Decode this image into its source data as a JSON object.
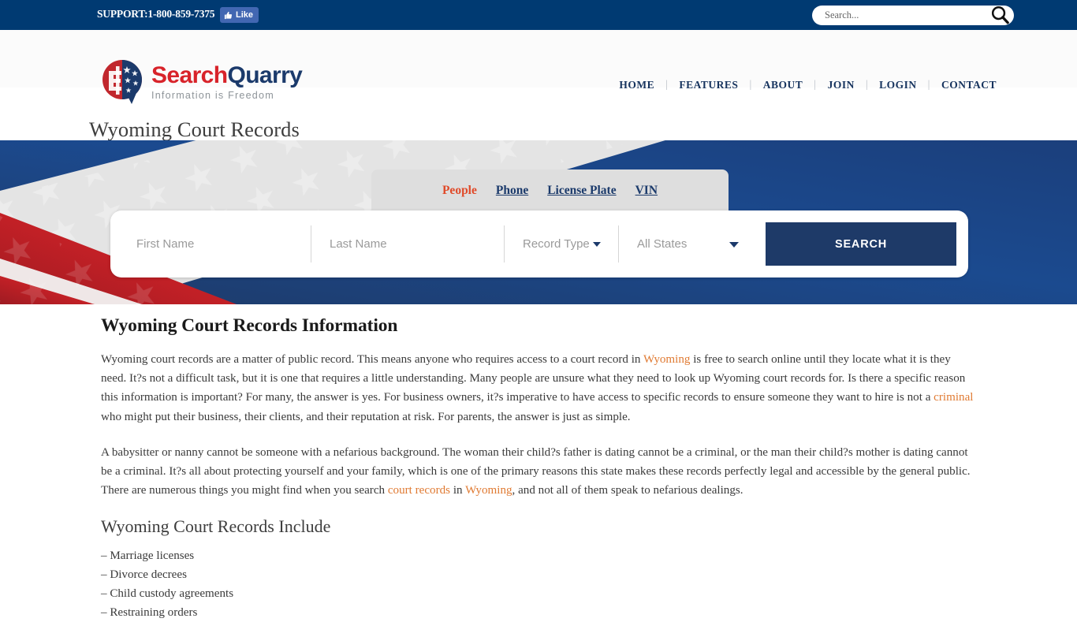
{
  "topbar": {
    "support": "SUPPORT:1-800-859-7375",
    "like_label": "Like",
    "search_placeholder": "Search...",
    "search_value": ""
  },
  "brand": {
    "name_part1": "Search",
    "name_part2": "Quarry",
    "tagline": "Information is Freedom"
  },
  "nav": {
    "items": [
      {
        "label": "HOME"
      },
      {
        "label": "FEATURES"
      },
      {
        "label": "ABOUT"
      },
      {
        "label": "JOIN"
      },
      {
        "label": "LOGIN"
      },
      {
        "label": "CONTACT"
      }
    ],
    "separator": "|"
  },
  "page": {
    "title": "Wyoming Court Records"
  },
  "search_widget": {
    "tabs": [
      {
        "label": "People",
        "active": true
      },
      {
        "label": "Phone",
        "active": false
      },
      {
        "label": "License Plate",
        "active": false
      },
      {
        "label": "VIN",
        "active": false
      }
    ],
    "first_name_placeholder": "First Name",
    "first_name_value": "",
    "last_name_placeholder": "Last Name",
    "last_name_value": "",
    "record_type_value": "Record Type",
    "state_value": "All States",
    "submit_label": "SEARCH"
  },
  "main": {
    "heading": "Wyoming Court Records Information",
    "paragraph1": {
      "seg1": "Wyoming court records are a matter of public record. This means anyone who requires access to a court record in ",
      "link1": "Wyoming",
      "seg2": " is free to search online until they locate what it is they need. It?s not a difficult task, but it is one that requires a little understanding. Many people are unsure what they need to look up Wyoming court records for. Is there a specific reason this information is important? For many, the answer is yes. For business owners, it?s imperative to have access to specific records to ensure someone they want to hire is not a ",
      "link2": "criminal",
      "seg3": " who might put their business, their clients, and their reputation at risk. For parents, the answer is just as simple."
    },
    "paragraph2": {
      "seg1": "A babysitter or nanny cannot be someone with a nefarious background. The woman their child?s father is dating cannot be a criminal, or the man their child?s mother is dating cannot be a criminal. It?s all about protecting yourself and your family, which is one of the primary reasons this state makes these records perfectly legal and accessible by the general public. There are numerous things you might find when you search ",
      "link1": "court records",
      "seg2": " in ",
      "link2": "Wyoming",
      "seg3": ", and not all of them speak to nefarious dealings."
    },
    "subheading": "Wyoming Court Records Include",
    "list": [
      "– Marriage licenses",
      "– Divorce decrees",
      "– Child custody agreements",
      "– Restraining orders"
    ]
  },
  "colors": {
    "topbar_navy": "#003a72",
    "hero_navy": "#1e3a68",
    "brand_red": "#d8232a",
    "brand_navy": "#1b3a6b",
    "link_orange": "#e07a32",
    "tab_active": "#e04a29",
    "facebook_blue": "#4267B2"
  }
}
